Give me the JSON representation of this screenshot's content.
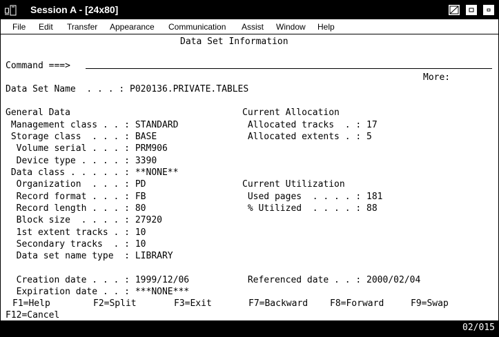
{
  "window": {
    "title": "Session A - [24x80]"
  },
  "menu": [
    "File",
    "Edit",
    "Transfer",
    "Appearance",
    "Communication",
    "Assist",
    "Window",
    "Help"
  ],
  "screen": {
    "panel_title": "Data Set Information",
    "command_label": "Command ===>",
    "more": "More:          +",
    "dsn_label": "Data Set Name  . . . : ",
    "dsn_value": "P020136.PRIVATE.TABLES",
    "general_head": "General Data",
    "mgmt_label": " Management class . . : ",
    "mgmt_value": "STANDARD",
    "storage_label": " Storage class  . . . : ",
    "storage_value": "BASE",
    "vol_label": "  Volume serial . . . : ",
    "vol_value": "PRM906",
    "dev_label": "  Device type . . . . : ",
    "dev_value": "3390",
    "dataclass_label": " Data class . . . . . : ",
    "dataclass_value": "**NONE**",
    "org_label": "  Organization  . . . : ",
    "org_value": "PD",
    "recfm_label": "  Record format . . . : ",
    "recfm_value": "FB",
    "lrecl_label": "  Record length . . . : ",
    "lrecl_value": "80",
    "blk_label": "  Block size  . . . . : ",
    "blk_value": "27920",
    "ext1_label": "  1st extent tracks . : ",
    "ext1_value": "10",
    "sec_label": "  Secondary tracks  . : ",
    "sec_value": "10",
    "dsntype_label": "  Data set name type  : ",
    "dsntype_value": "LIBRARY",
    "alloc_head": "Current Allocation",
    "trk_label": " Allocated tracks  . : ",
    "trk_value": "17",
    "ext_label": " Allocated extents . : ",
    "ext_value": "5",
    "util_head": "Current Utilization",
    "pages_label": " Used pages  . . . . : ",
    "pages_value": "181",
    "pct_label": " % Utilized  . . . . : ",
    "pct_value": "88",
    "cdate_label": "  Creation date . . . : ",
    "cdate_value": "1999/12/06",
    "rdate_label": " Referenced date . . : ",
    "rdate_value": "2000/02/04",
    "xdate_label": "  Expiration date . . : ",
    "xdate_value": "***NONE***",
    "pf": {
      "f1": "F1=Help",
      "f2": "F2=Split",
      "f3": "F3=Exit",
      "f7": "F7=Backward",
      "f8": "F8=Forward",
      "f9": "F9=Swap",
      "f12": "F12=Cancel"
    }
  },
  "status": {
    "position": "02/015"
  }
}
